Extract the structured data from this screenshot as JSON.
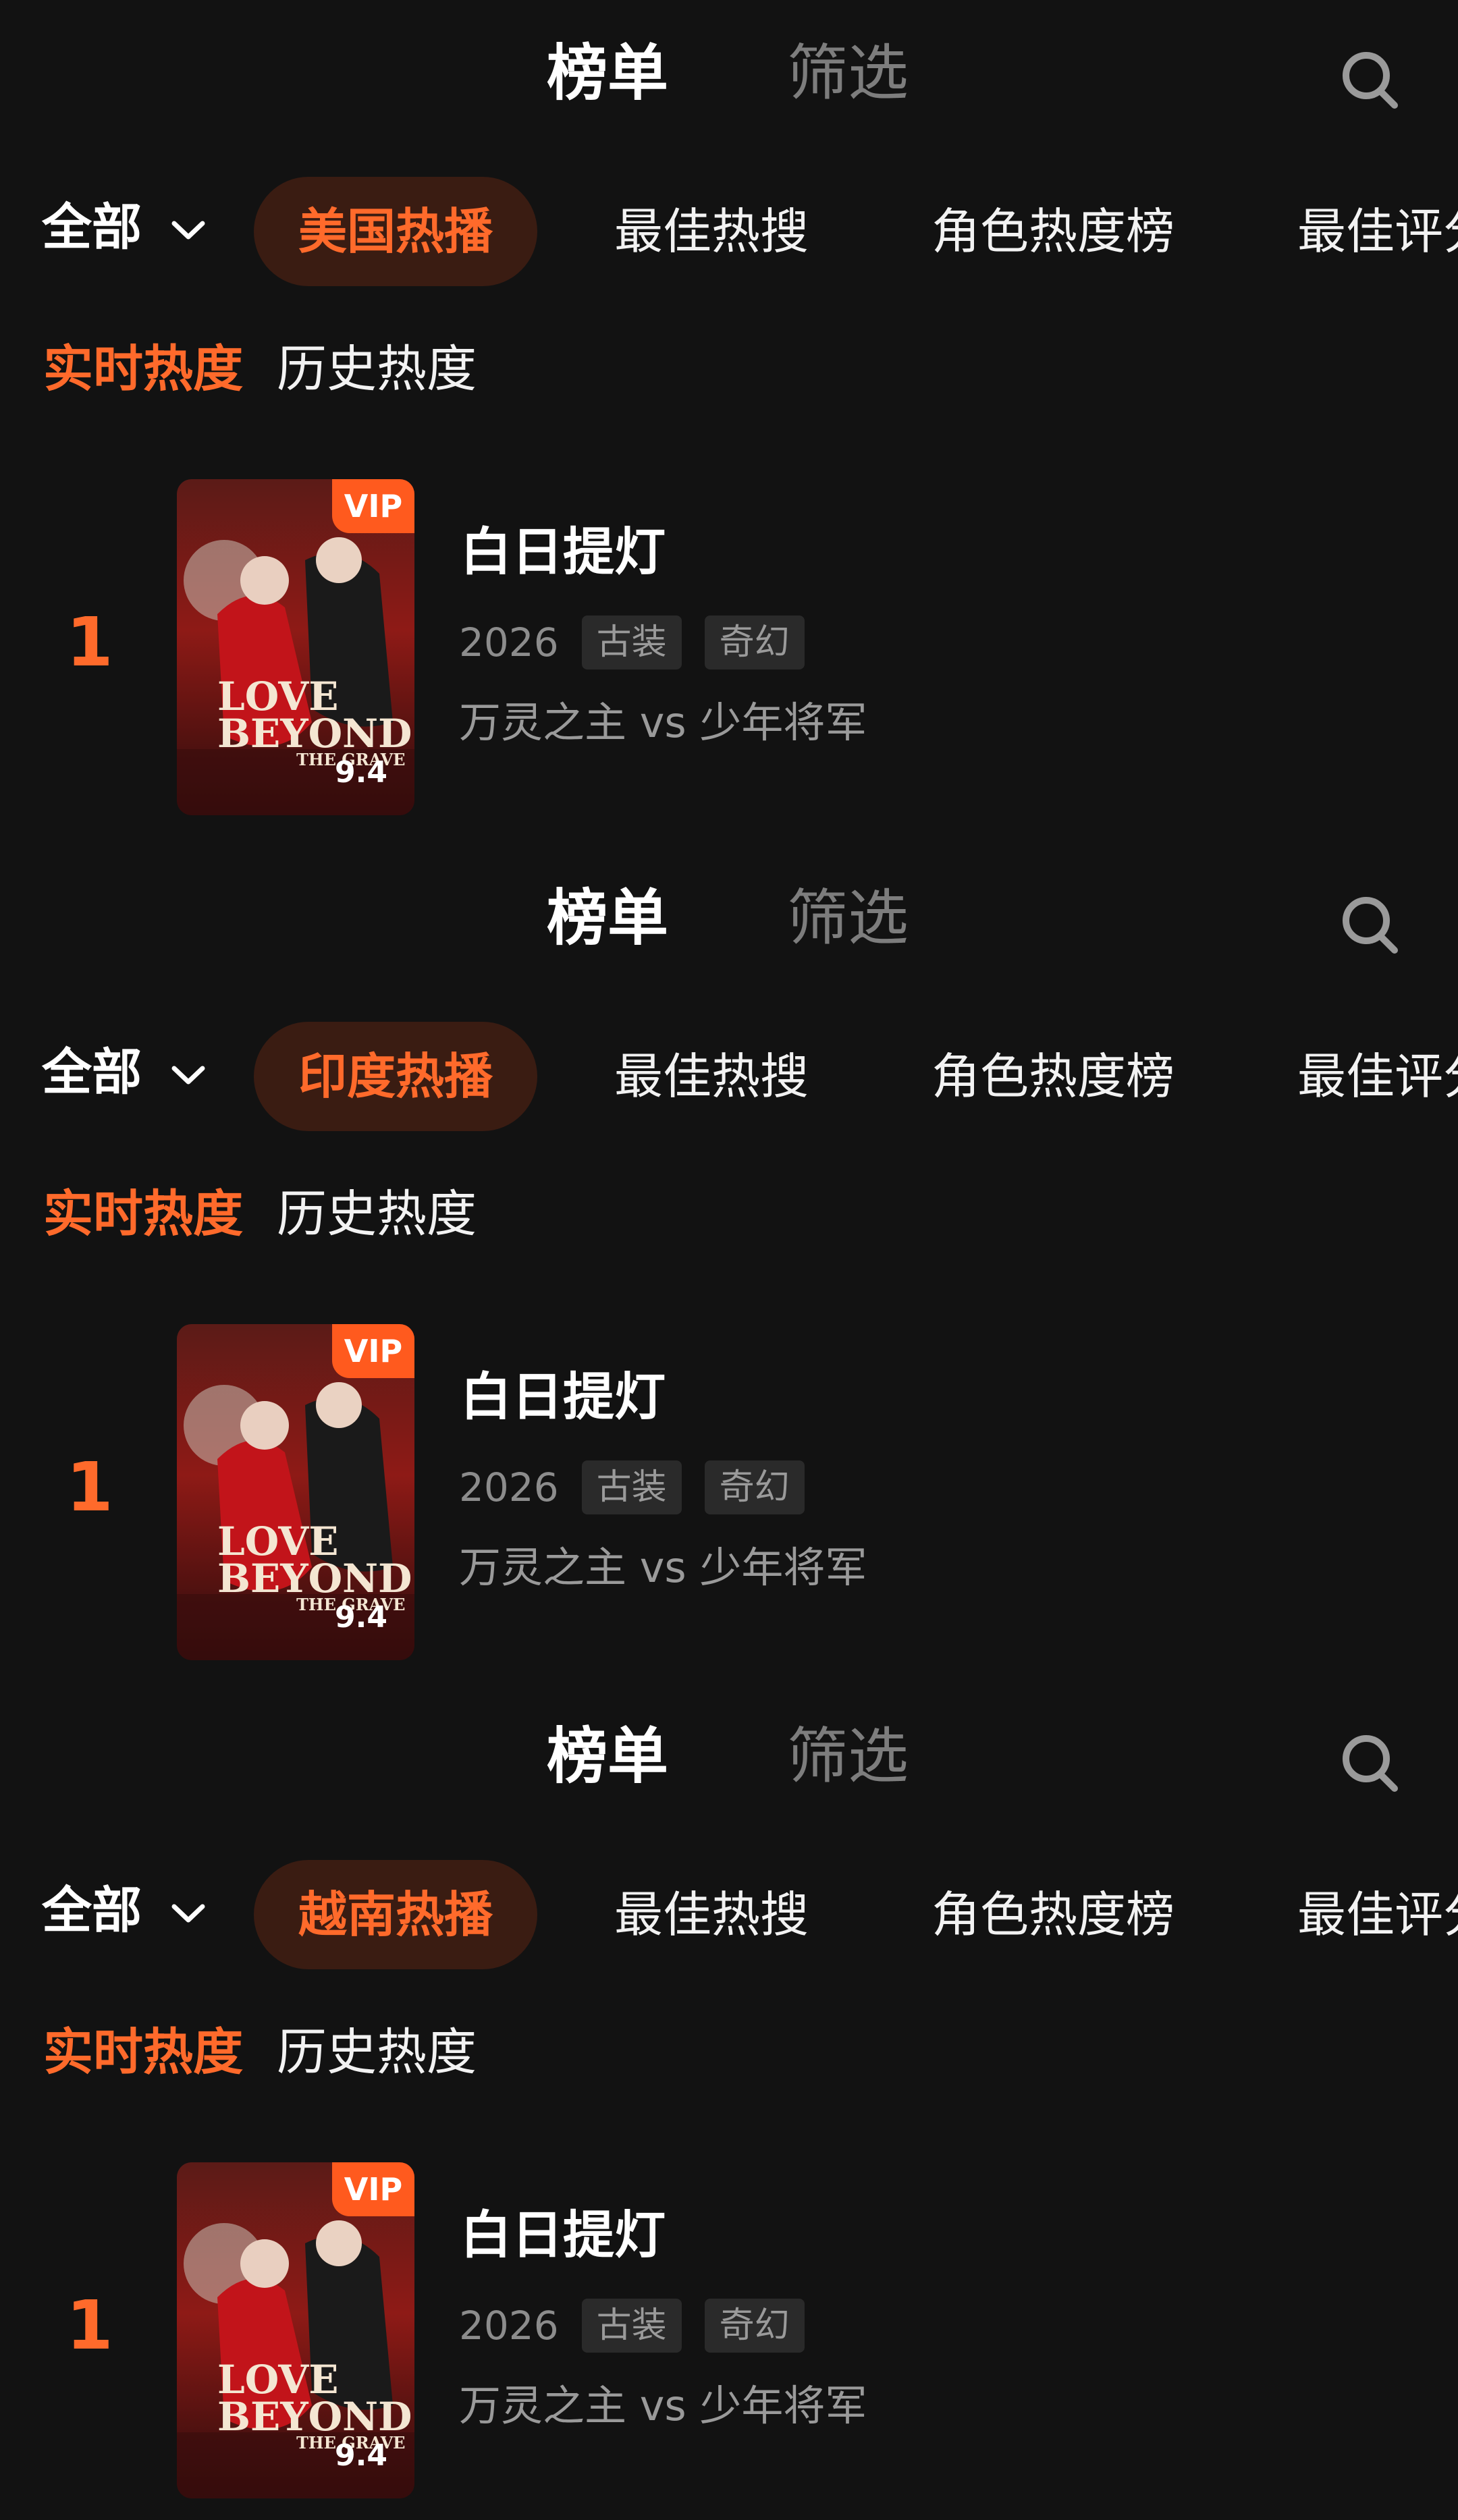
{
  "header": {
    "tab_rank": "榜单",
    "tab_filter": "筛选"
  },
  "filter": {
    "all_label": "全部",
    "chip_hot_search": "最佳热搜",
    "chip_role": "角色热度榜",
    "chip_best_rating": "最佳评分"
  },
  "subtabs": {
    "realtime": "实时热度",
    "history": "历史热度"
  },
  "item": {
    "rank": "1",
    "vip": "VIP",
    "title": "白日提灯",
    "year": "2026",
    "tags": [
      "古装",
      "奇幻"
    ],
    "desc": "万灵之主 vs 少年将军",
    "poster_title_line1": "LOVE",
    "poster_title_line2": "BEYOND",
    "poster_title_line3": "THE GRAVE",
    "score": "9.4"
  },
  "panels": [
    {
      "selected_chip": "美国热播"
    },
    {
      "selected_chip": "印度热播"
    },
    {
      "selected_chip": "越南热播"
    }
  ],
  "colors": {
    "accent": "#ff6a2b",
    "background": "#121212",
    "vip": "#ff5a1e"
  },
  "icons": {
    "search": "search-icon",
    "dropdown": "chevron-down-icon"
  }
}
